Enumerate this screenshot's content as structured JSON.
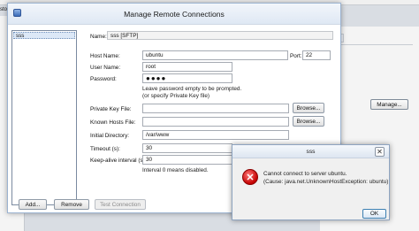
{
  "background": {
    "menu_text": "stor",
    "tab_label": "ssh",
    "manage_button": "Manage..."
  },
  "dialog": {
    "title": "Manage Remote Connections",
    "connections": [
      "sss"
    ],
    "name_label": "Name:",
    "name_value": "sss [SFTP]",
    "host_label": "Host Name:",
    "host_value": "ubuntu",
    "port_label": "Port:",
    "port_value": "22",
    "user_label": "User Name:",
    "user_value": "root",
    "password_label": "Password:",
    "password_mask": "●●●●",
    "password_hint_1": "Leave password empty to be prompted.",
    "password_hint_2": "(or specify Private Key file)",
    "private_key_label": "Private Key File:",
    "private_key_value": "",
    "known_hosts_label": "Known Hosts File:",
    "known_hosts_value": "",
    "initial_dir_label": "Initial Directory:",
    "initial_dir_value": "/var/www",
    "timeout_label": "Timeout (s):",
    "timeout_value": "30",
    "keepalive_label": "Keep-alive interval (s):",
    "keepalive_value": "30",
    "keepalive_note": "Interval 0 means disabled.",
    "browse_label": "Browse...",
    "add_label": "Add...",
    "remove_label": "Remove",
    "test_label": "Test Connection"
  },
  "error_dialog": {
    "title": "sss",
    "close_glyph": "✕",
    "icon_glyph": "✕",
    "message_1": "Cannot connect to server ubuntu.",
    "message_2": "(Cause: java.net.UnknownHostException: ubuntu)",
    "ok_label": "OK"
  }
}
